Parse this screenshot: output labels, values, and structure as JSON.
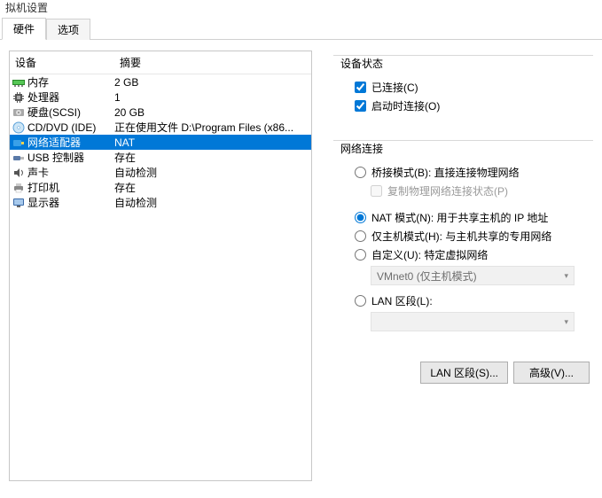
{
  "window": {
    "title_fragment": "拟机设置"
  },
  "tabs": {
    "hardware": "硬件",
    "options": "选项"
  },
  "device_list": {
    "header_device": "设备",
    "header_summary": "摘要",
    "rows": [
      {
        "id": "memory",
        "label": "内存",
        "summary": "2 GB"
      },
      {
        "id": "cpu",
        "label": "处理器",
        "summary": "1"
      },
      {
        "id": "hdd",
        "label": "硬盘(SCSI)",
        "summary": "20 GB"
      },
      {
        "id": "cd",
        "label": "CD/DVD (IDE)",
        "summary": "正在使用文件 D:\\Program Files (x86..."
      },
      {
        "id": "net",
        "label": "网络适配器",
        "summary": "NAT"
      },
      {
        "id": "usb",
        "label": "USB 控制器",
        "summary": "存在"
      },
      {
        "id": "sound",
        "label": "声卡",
        "summary": "自动检测"
      },
      {
        "id": "printer",
        "label": "打印机",
        "summary": "存在"
      },
      {
        "id": "display",
        "label": "显示器",
        "summary": "自动检测"
      }
    ]
  },
  "status": {
    "group_title": "设备状态",
    "connected": "已连接(C)",
    "connect_at_poweron": "启动时连接(O)"
  },
  "net": {
    "group_title": "网络连接",
    "bridged": "桥接模式(B): 直接连接物理网络",
    "replicate": "复制物理网络连接状态(P)",
    "nat": "NAT 模式(N): 用于共享主机的 IP 地址",
    "hostonly": "仅主机模式(H): 与主机共享的专用网络",
    "custom": "自定义(U): 特定虚拟网络",
    "custom_combo": "VMnet0 (仅主机模式)",
    "lan_segment": "LAN 区段(L):",
    "lan_combo": ""
  },
  "buttons": {
    "lan_segments": "LAN 区段(S)...",
    "advanced": "高级(V)..."
  },
  "colors": {
    "selection": "#0078d7"
  }
}
